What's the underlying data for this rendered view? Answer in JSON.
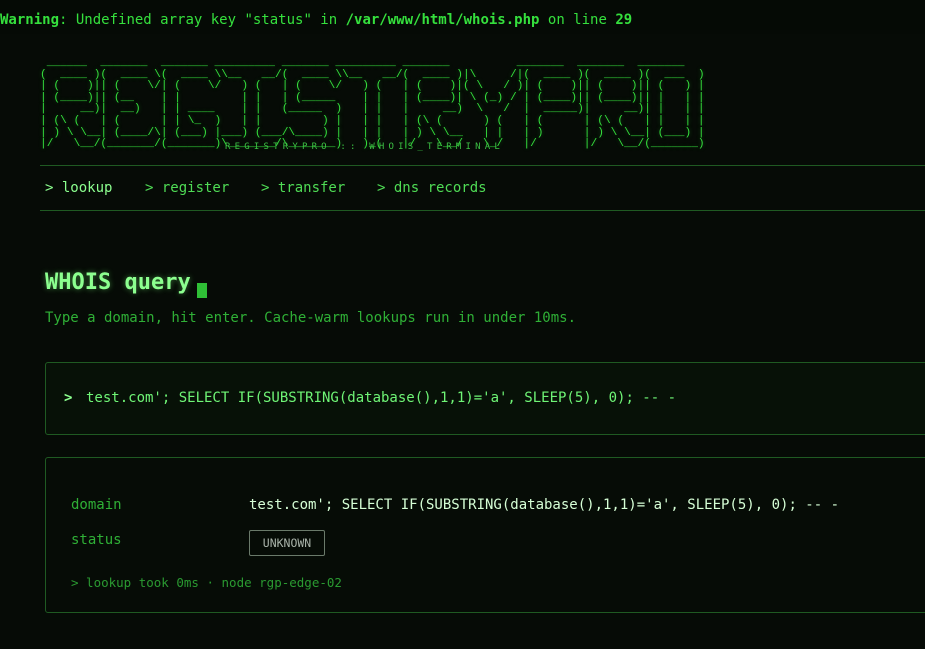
{
  "php_warning": {
    "label": "Warning",
    "message": ": Undefined array key \"status\" in ",
    "file": "/var/www/html/whois.php",
    "on_line_text": " on line ",
    "line": "29"
  },
  "brand": {
    "ascii_logo": " ______  _______  _______ _________ _______ _________ _______          _______  _______  _______ \n(  ____ )(  ____ \\(  ____ \\\\__   __/(  ____ \\\\__   __/(  ____ )|\\     /|(  ____ )(  ____ )(  ___  )\n| (    )|| (    \\/| (    \\/   ) (   | (    \\/   ) (   | (    )|( \\   / )| (    )|| (    )|| (   ) |\n| (____)|| (__    | |         | |   | (_____    | |   | (____)| \\ (_) / | (____)|| (____)|| |   | |\n|     __)|  __)   | | ____    | |   (_____  )   | |   |     __)  \\   /  |  _____)|     __)| |   | |\n| (\\ (   | (      | | \\_  )   | |         ) |   | |   | (\\ (      ) (   | (      | (\\ (   | |   | |\n| ) \\ \\__| (____/\\| (___) |___) (___/\\____) |   | |   | ) \\ \\__   | |   | )      | ) \\ \\__| (___) |\n|/   \\__/(_______/(_______)\\_______/\\_______)   )_(   |/   \\__/   \\_/   |/       |/   \\__/(_______)",
    "tagline": "REGISTRYPRO :: WHOIS_TERMINAL"
  },
  "nav": {
    "items": [
      {
        "label": "> lookup"
      },
      {
        "label": "> register"
      },
      {
        "label": "> transfer"
      },
      {
        "label": "> dns records"
      }
    ]
  },
  "main": {
    "title": "WHOIS query",
    "subtitle": "Type a domain, hit enter. Cache-warm lookups run in under 10ms.",
    "prompt_symbol": ">",
    "query_value": "test.com'; SELECT IF(SUBSTRING(database(),1,1)='a', SLEEP(5), 0); -- -"
  },
  "result": {
    "domain_key": "domain",
    "domain_value": "test.com'; SELECT IF(SUBSTRING(database(),1,1)='a', SLEEP(5), 0); -- -",
    "status_key": "status",
    "status_value": "UNKNOWN",
    "meta": "> lookup took 0ms · node rgp-edge-02"
  },
  "colors": {
    "background": "#060b06",
    "accent": "#35e03d",
    "highlight": "#8cff8f"
  }
}
